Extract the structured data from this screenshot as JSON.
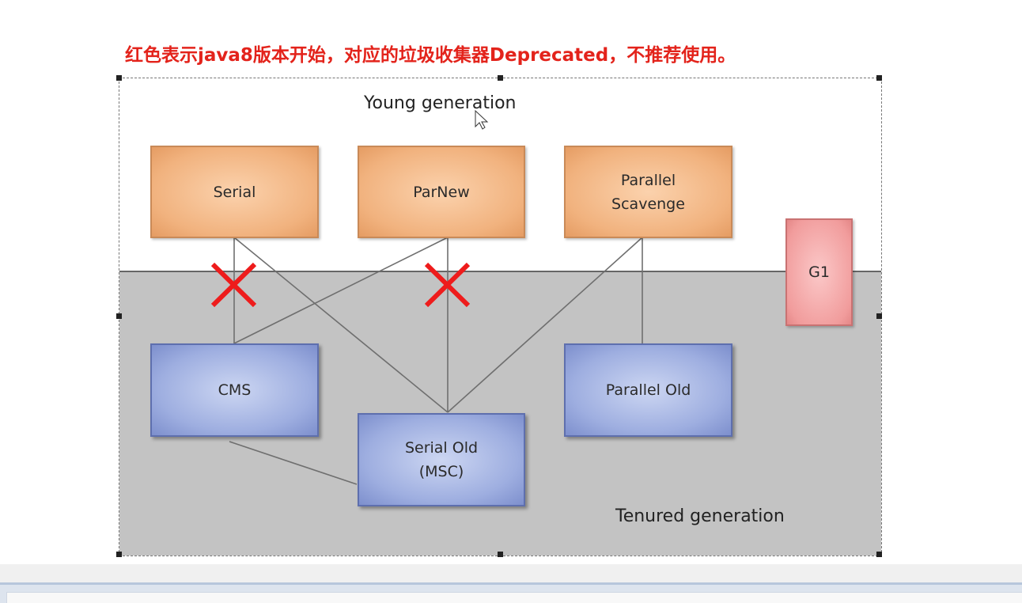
{
  "note": "红色表示java8版本开始，对应的垃圾收集器Deprecated，不推荐使用。",
  "zones": {
    "young": "Young generation",
    "tenured": "Tenured generation"
  },
  "collectors": {
    "serial": "Serial",
    "parnew": "ParNew",
    "parallel_scavenge": "Parallel\nScavenge",
    "cms": "CMS",
    "serial_old": "Serial Old\n(MSC)",
    "parallel_old": "Parallel Old",
    "g1": "G1"
  },
  "connections": [
    {
      "from": "Serial",
      "to": "CMS",
      "deprecated": true
    },
    {
      "from": "Serial",
      "to": "Serial Old (MSC)",
      "deprecated": false
    },
    {
      "from": "ParNew",
      "to": "CMS",
      "deprecated": false
    },
    {
      "from": "ParNew",
      "to": "Serial Old (MSC)",
      "deprecated": true
    },
    {
      "from": "Parallel Scavenge",
      "to": "Serial Old (MSC)",
      "deprecated": false
    },
    {
      "from": "Parallel Scavenge",
      "to": "Parallel Old",
      "deprecated": false
    },
    {
      "from": "CMS",
      "to": "Serial Old (MSC)",
      "deprecated": false
    }
  ],
  "colors": {
    "note": "#e3231b",
    "deprecated_mark": "#ee1c1c",
    "young_box": "#f1b27e",
    "old_box": "#9eaee0",
    "g1_box": "#f19c9c",
    "tenured_background": "#c3c3c3"
  }
}
